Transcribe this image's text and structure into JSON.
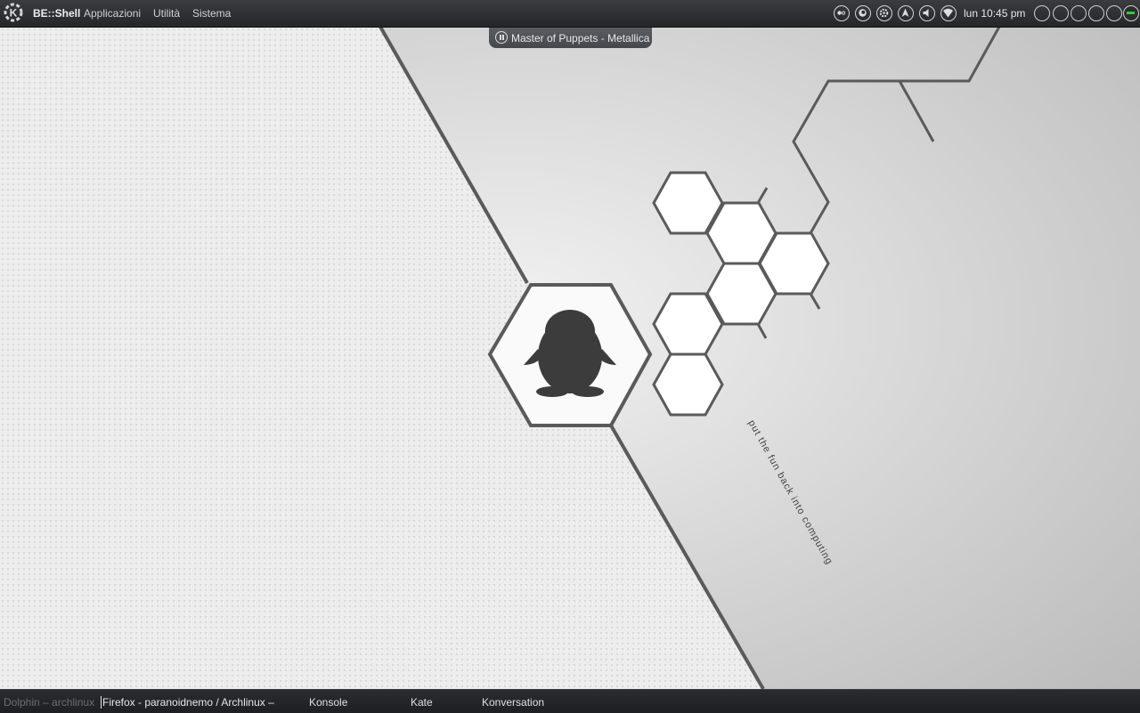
{
  "top_panel": {
    "title": "BE::Shell",
    "menu": [
      "Applicazioni",
      "Utilità",
      "Sistema"
    ],
    "tray_icons": [
      "media-icon",
      "firefox-icon",
      "settings-icon",
      "update-icon",
      "volume-icon",
      "wifi-icon"
    ],
    "clock": "lun 10:45 pm",
    "desktops": 6,
    "active_desktop": 6
  },
  "now_playing": {
    "text": "Master of Puppets - Metallica"
  },
  "wallpaper": {
    "tagline": "put the fun back into computing"
  },
  "taskbar": {
    "tasks": [
      {
        "label": "Dolphin – archlinux",
        "state": "minimized"
      },
      {
        "label": "Firefox - paranoidnemo / Archlinux –",
        "state": "active"
      },
      {
        "label": "Konsole",
        "state": "normal"
      },
      {
        "label": "Kate",
        "state": "normal"
      },
      {
        "label": "Konversation",
        "state": "normal"
      }
    ]
  },
  "colors": {
    "panel": "#2a2c30",
    "active_desktop_indicator": "#2ecc40",
    "wallpaper_left": "#efefef",
    "wallpaper_right": "#d0d0d0",
    "hex_stroke": "#555555"
  }
}
